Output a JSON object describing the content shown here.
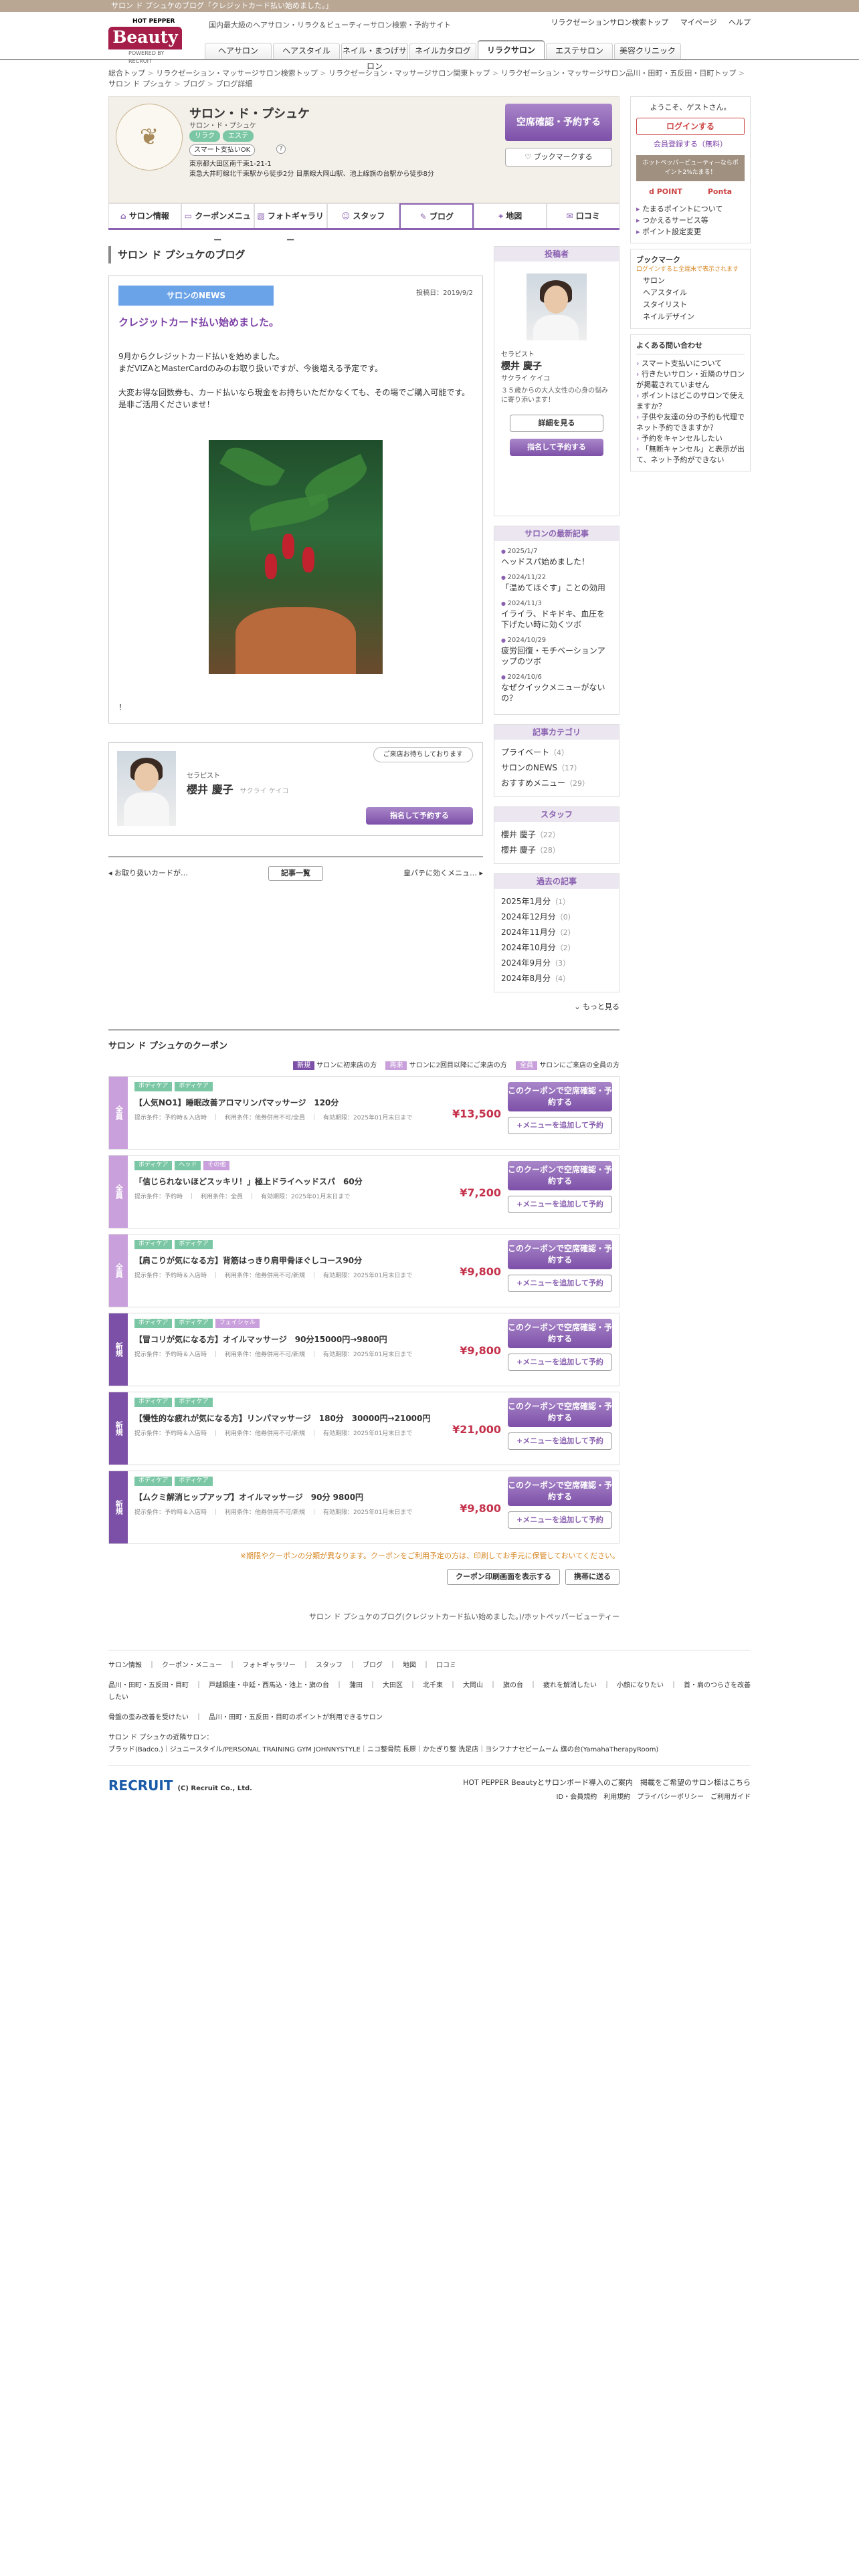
{
  "topbar": "サロン ド プシュケのブログ「クレジットカード払い始めました。」",
  "header": {
    "hp": "HOT PEPPER",
    "beauty": "Beauty",
    "powered": "POWERED BY RECRUIT",
    "tagline": "国内最大級のヘアサロン・リラク＆ビューティーサロン検索・予約サイト",
    "links": [
      "リラクゼーションサロン検索トップ",
      "マイページ",
      "ヘルプ"
    ]
  },
  "gnav": [
    "ヘアサロン",
    "ヘアスタイル",
    "ネイル・まつげサロン",
    "ネイルカタログ",
    "リラクサロン",
    "エステサロン",
    "美容クリニック"
  ],
  "breadcrumb": [
    "総合トップ",
    "リラクゼーション・マッサージサロン検索トップ",
    "リラクゼーション・マッサージサロン関東トップ",
    "リラクゼーション・マッサージサロン品川・田町・五反田・目町トップ",
    "サロン ド プシュケ",
    "ブログ",
    "ブログ詳細"
  ],
  "salon": {
    "name": "サロン・ド・プシュケ",
    "kana": "サロン・ド・プシュケ",
    "tags": [
      "リラク",
      "エステ"
    ],
    "pay": "スマート支払いOK",
    "q": "?",
    "addr1": "東京都大田区南千束1-21-1",
    "addr2": "東急大井町線北千束駅から徒歩2分 目黒線大岡山駅、池上線旗の台駅から徒歩8分",
    "reserve": "空席確認・予約する",
    "bookmark": "ブックマークする",
    "logo": "❦"
  },
  "tabs": [
    {
      "ic": "⌂",
      "label": "サロン情報"
    },
    {
      "ic": "▭",
      "label": "クーポンメニュー"
    },
    {
      "ic": "▧",
      "label": "フォトギャラリー"
    },
    {
      "ic": "☺",
      "label": "スタッフ"
    },
    {
      "ic": "✎",
      "label": "ブログ"
    },
    {
      "ic": "⌖",
      "label": "地図"
    },
    {
      "ic": "✉",
      "label": "口コミ"
    }
  ],
  "blog": {
    "heading": "サロン ド プシュケのブログ",
    "badge": "サロンのNEWS",
    "date": "投稿日：2019/9/2",
    "title": "クレジットカード払い始めました。",
    "lines": [
      "9月からクレジットカード払いを始めました。",
      "まだVIZAとMasterCardのみのお取り扱いですが、今後増える予定です。",
      "",
      "大変お得な回数券も、カード払いなら現金をお持ちいただかなくても、その場でご購入可能です。",
      "是非ご活用くださいませ！"
    ],
    "end": "！"
  },
  "staffcard": {
    "bubble": "ご来店お待ちしております",
    "role": "セラピスト",
    "name": "櫻井 慶子",
    "kana": "サクライ ケイコ",
    "btn": "指名して予約する"
  },
  "pager": {
    "prev": "お取り扱いカードが…",
    "list": "記事一覧",
    "next": "皇パテに効くメニュ…"
  },
  "poster": {
    "h": "投稿者",
    "role": "セラピスト",
    "name": "櫻井 慶子",
    "kana": "サクライ ケイコ",
    "desc": "３５歳からの大人女性の心身の悩みに寄り添います！",
    "b1": "詳細を見る",
    "b2": "指名して予約する"
  },
  "recent": {
    "h": "サロンの最新記事",
    "items": [
      {
        "d": "2025/1/7",
        "t": "ヘッドスパ始めました！"
      },
      {
        "d": "2024/11/22",
        "t": "「温めてほぐす」ことの効用"
      },
      {
        "d": "2024/11/3",
        "t": "イライラ、ドキドキ、血圧を下げたい時に効くツボ"
      },
      {
        "d": "2024/10/29",
        "t": "疲労回復・モチベーションアップのツボ"
      },
      {
        "d": "2024/10/6",
        "t": "なぜクイックメニューがないの？"
      }
    ]
  },
  "cats": {
    "h": "記事カテゴリ",
    "items": [
      {
        "n": "プライベート",
        "c": "（4）"
      },
      {
        "n": "サロンのNEWS",
        "c": "（17）"
      },
      {
        "n": "おすすめメニュー",
        "c": "（29）"
      }
    ]
  },
  "staff": {
    "h": "スタッフ",
    "items": [
      {
        "n": "櫻井 慶子",
        "c": "（22）"
      },
      {
        "n": "櫻井 慶子",
        "c": "（28）"
      }
    ]
  },
  "archive": {
    "h": "過去の記事",
    "items": [
      {
        "n": "2025年1月分",
        "c": "（1）"
      },
      {
        "n": "2024年12月分",
        "c": "（0）"
      },
      {
        "n": "2024年11月分",
        "c": "（2）"
      },
      {
        "n": "2024年10月分",
        "c": "（2）"
      },
      {
        "n": "2024年9月分",
        "c": "（3）"
      },
      {
        "n": "2024年8月分",
        "c": "（4）"
      }
    ],
    "more": "もっと見る"
  },
  "coupons": {
    "h": "サロン ド プシュケのクーポン",
    "legend": [
      {
        "b": "新規",
        "t": "サロンに初来店の方",
        "c": "#7d50a8"
      },
      {
        "b": "再来",
        "t": "サロンに2回目以降にご来店の方",
        "c": "#c9a0dc"
      },
      {
        "b": "全員",
        "t": "サロンにご来店の全員の方",
        "c": "#c9a0dc"
      }
    ],
    "items": [
      {
        "side": "全員",
        "sc": "#c9a0dc",
        "tags": [
          "ボディケア",
          "ボディケア"
        ],
        "title": "【人気NO1】睡眠改善アロマリンパマッサージ　120分",
        "price": "¥13,500",
        "note": "提示条件：予約時＆入店時　｜　利用条件：他券併用不可/全員　｜　有効期限：2025年01月末日まで"
      },
      {
        "side": "全員",
        "sc": "#c9a0dc",
        "tags": [
          "ボディケア",
          "ヘッド",
          "その他"
        ],
        "title": "「信じられないほどスッキリ！」極上ドライヘッドスパ　60分",
        "price": "¥7,200",
        "note": "提示条件：予約時　｜　利用条件：全員　｜　有効期限：2025年01月末日まで"
      },
      {
        "side": "全員",
        "sc": "#c9a0dc",
        "tags": [
          "ボディケア",
          "ボディケア"
        ],
        "title": "【肩こりが気になる方】背筋はっきり肩甲骨ほぐしコース90分",
        "price": "¥9,800",
        "note": "提示条件：予約時＆入店時　｜　利用条件：他券併用不可/新規　｜　有効期限：2025年01月末日まで"
      },
      {
        "side": "新規",
        "sc": "#7d50a8",
        "tags": [
          "ボディケア",
          "ボディケア",
          "フェイシャル"
        ],
        "title": "【冒コリが気になる方】オイルマッサージ　90分15000円→9800円",
        "price": "¥9,800",
        "note": "提示条件：予約時＆入店時　｜　利用条件：他券併用不可/新規　｜　有効期限：2025年01月末日まで"
      },
      {
        "side": "新規",
        "sc": "#7d50a8",
        "tags": [
          "ボディケア",
          "ボディケア"
        ],
        "title": "【慢性的な疲れが気になる方】リンパマッサージ　180分　30000円→21000円",
        "price": "¥21,000",
        "note": "提示条件：予約時＆入店時　｜　利用条件：他券併用不可/新規　｜　有効期限：2025年01月末日まで"
      },
      {
        "side": "新規",
        "sc": "#7d50a8",
        "tags": [
          "ボディケア",
          "ボディケア"
        ],
        "title": "【ムクミ解消ヒップアップ】オイルマッサージ　90分 9800円",
        "price": "¥9,800",
        "note": "提示条件：予約時＆入店時　｜　利用条件：他券併用不可/新規　｜　有効期限：2025年01月末日まで"
      }
    ],
    "b1": "このクーポンで空席確認・予約する",
    "b2": "+メニューを追加して予約",
    "warn": "※期限やクーポンの分類が異なります。クーポンをご利用予定の方は、印刷してお手元に保管しておいてください。",
    "print": "クーポン印刷画面を表示する",
    "mobile": "携帯に送る"
  },
  "footlink": "サロン ド プシュケのブログ(クレジットカード払い始めました。)/ホットペッパービューティー",
  "fnav": [
    "サロン情報　｜　クーポン・メニュー　｜　フォトギャラリー　｜　スタッフ　｜　ブログ　｜　地図　｜　口コミ",
    "品川・田町・五反田・目町　｜　戸越銀座・中延・西馬込・池上・旗の台　｜　蒲田　｜　大田区　｜　北千束　｜　大岡山　｜　旗の台　｜　疲れを解消したい　｜　小顔になりたい　｜　首・肩のつらさを改善したい",
    "骨盤の歪み改善を受けたい　｜　品川・田町・五反田・目町のポイントが利用できるサロン",
    "サロン ド プシュケの近隣サロン：",
    "ブラッド(Badco.)｜ジュニースタイル/PERSONAL TRAINING GYM JOHNNYSTYLE｜ニコ整骨院 長原｜かたぎり整 洗足店｜ヨシフナナセビームーム 旗の台(YamahaTherapyRoom)"
  ],
  "foot": {
    "recruit": "RECRUIT",
    "copy": "(C) Recruit Co., Ltd.",
    "r1": "HOT PEPPER Beautyとサロンボード導入のご案内　掲載をご希望のサロン様はこちら",
    "r2": "ID・会員規約　利用規約　プライバシーポリシー　ご利用ガイド"
  },
  "sidebar": {
    "welcome": "ようこそ、ゲストさん。",
    "login": "ログインする",
    "reg": "会員登録する（無料）",
    "promo": "ホットペッパービューティーならポイント2%たまる！",
    "pts": [
      "d POINT",
      "Ponta"
    ],
    "links": [
      "たまるポイントについて",
      "つかえるサービス等",
      "ポイント設定変更"
    ],
    "bm": "ブックマーク",
    "bmnote": "ログインすると全端末で表示されます",
    "bmitems": [
      "サロン",
      "ヘアスタイル",
      "スタイリスト",
      "ネイルデザイン"
    ],
    "faqh": "よくある問い合わせ",
    "faq": [
      "スマート支払いについて",
      "行きたいサロン・近隣のサロンが掲載されていません",
      "ポイントはどこのサロンで使えますか？",
      "子供や友達の分の予約も代理でネット予約できますか？",
      "予約をキャンセルしたい",
      "「無断キャンセル」と表示が出て、ネット予約ができない"
    ]
  }
}
